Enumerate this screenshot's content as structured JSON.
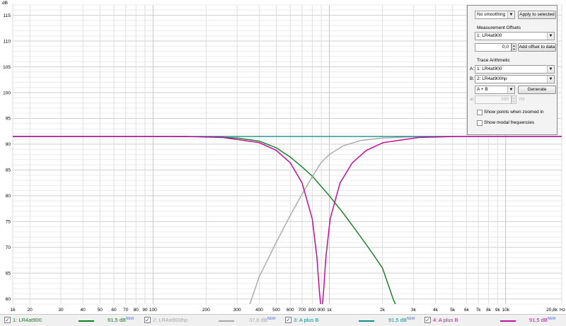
{
  "chart_data": {
    "type": "line",
    "xscale": "log",
    "xlim": [
      16,
      20800
    ],
    "ylim": [
      59,
      117
    ],
    "ylabel": "dB",
    "xunit": "Hz",
    "grid": true,
    "x_tick_labels": [
      {
        "v": 16,
        "t": "16"
      },
      {
        "v": 20,
        "t": "20"
      },
      {
        "v": 30,
        "t": "30"
      },
      {
        "v": 40,
        "t": "40"
      },
      {
        "v": 50,
        "t": "50"
      },
      {
        "v": 60,
        "t": "60"
      },
      {
        "v": 70,
        "t": "70"
      },
      {
        "v": 80,
        "t": "80"
      },
      {
        "v": 90,
        "t": "90"
      },
      {
        "v": 100,
        "t": "100"
      },
      {
        "v": 200,
        "t": "200"
      },
      {
        "v": 300,
        "t": "300"
      },
      {
        "v": 400,
        "t": "400"
      },
      {
        "v": 500,
        "t": "500"
      },
      {
        "v": 600,
        "t": "600"
      },
      {
        "v": 700,
        "t": "700"
      },
      {
        "v": 800,
        "t": "800"
      },
      {
        "v": 900,
        "t": "900"
      },
      {
        "v": 1000,
        "t": "1k"
      },
      {
        "v": 2000,
        "t": "2k"
      },
      {
        "v": 3000,
        "t": "3k"
      },
      {
        "v": 4000,
        "t": "4k"
      },
      {
        "v": 5000,
        "t": "5k"
      },
      {
        "v": 6000,
        "t": "6k"
      },
      {
        "v": 7000,
        "t": "7k"
      },
      {
        "v": 8000,
        "t": "8k"
      },
      {
        "v": 9000,
        "t": "9k"
      },
      {
        "v": 10000,
        "t": "10k"
      },
      {
        "v": 20800,
        "t": "20,8k"
      }
    ],
    "y_tick_labels": [
      {
        "v": 60,
        "t": "60"
      },
      {
        "v": 65,
        "t": "65"
      },
      {
        "v": 70,
        "t": "70"
      },
      {
        "v": 75,
        "t": "75"
      },
      {
        "v": 80,
        "t": "80"
      },
      {
        "v": 85,
        "t": "85"
      },
      {
        "v": 90,
        "t": "90"
      },
      {
        "v": 95,
        "t": "95"
      },
      {
        "v": 100,
        "t": "100"
      },
      {
        "v": 105,
        "t": "105"
      },
      {
        "v": 110,
        "t": "110"
      },
      {
        "v": 115,
        "t": "115"
      }
    ],
    "series": [
      {
        "name": "1: LR4at900",
        "color": "#0f7d1f",
        "points": [
          [
            16,
            91.5
          ],
          [
            100,
            91.5
          ],
          [
            200,
            91.45
          ],
          [
            300,
            91.2
          ],
          [
            400,
            90.6
          ],
          [
            500,
            89.3
          ],
          [
            600,
            87.5
          ],
          [
            700,
            85.6
          ],
          [
            800,
            83.8
          ],
          [
            900,
            81.8
          ],
          [
            1000,
            80.0
          ],
          [
            1200,
            76.6
          ],
          [
            1400,
            73.5
          ],
          [
            1600,
            70.8
          ],
          [
            1800,
            68.3
          ],
          [
            2000,
            66.0
          ],
          [
            2300,
            60.0
          ],
          [
            2400,
            58.5
          ]
        ]
      },
      {
        "name": "2: LR4at900hp",
        "color": "#a8a8a8",
        "points": [
          [
            350,
            58.5
          ],
          [
            400,
            64.3
          ],
          [
            500,
            71.0
          ],
          [
            600,
            76.2
          ],
          [
            700,
            80.3
          ],
          [
            800,
            83.7
          ],
          [
            900,
            86.5
          ],
          [
            1000,
            88.0
          ],
          [
            1200,
            89.7
          ],
          [
            1500,
            90.7
          ],
          [
            2000,
            91.2
          ],
          [
            3000,
            91.45
          ],
          [
            5000,
            91.5
          ],
          [
            20800,
            91.5
          ]
        ]
      },
      {
        "name": "3: A plus B",
        "color": "#188a8a",
        "points": [
          [
            16,
            91.5
          ],
          [
            20800,
            91.5
          ]
        ]
      },
      {
        "name": "4: A plus B",
        "color": "#c0109c",
        "points": [
          [
            16,
            91.5
          ],
          [
            150,
            91.5
          ],
          [
            250,
            91.3
          ],
          [
            400,
            90.3
          ],
          [
            500,
            88.8
          ],
          [
            600,
            86.4
          ],
          [
            700,
            82.5
          ],
          [
            800,
            75.5
          ],
          [
            850,
            68.0
          ],
          [
            880,
            61.0
          ],
          [
            895,
            58.5
          ],
          [
            910,
            58.5
          ],
          [
            925,
            61.0
          ],
          [
            955,
            68.0
          ],
          [
            1010,
            75.5
          ],
          [
            1150,
            82.5
          ],
          [
            1350,
            86.4
          ],
          [
            1620,
            88.8
          ],
          [
            2020,
            90.3
          ],
          [
            3200,
            91.3
          ],
          [
            5400,
            91.5
          ],
          [
            20800,
            91.5
          ]
        ]
      }
    ]
  },
  "panel": {
    "smoothing_value": "No smoothing",
    "apply_label": "Apply to selected",
    "offsets_heading": "Measurement Offsets",
    "offset_meas": "1: LR4at900",
    "offset_value": "0,0",
    "add_offset_label": "Add offset to data",
    "arith_heading": "Trace Arithmetic",
    "a_label": "A:",
    "a_value": "1: LR4at900",
    "b_label": "B:",
    "b_value": "2: LR4at900hp",
    "op_value": "A + B",
    "generate_label": "Generate",
    "freq_prefix": "at",
    "freq_value": "200",
    "freq_unit": "Hz",
    "show_points_label": "Show points when zoomed in",
    "show_modal_label": "Show modal frequencies"
  },
  "legend": [
    {
      "name": "1: LR4at900",
      "value": "91,5 dB",
      "badge": "NEW",
      "color": "#0f7d1f",
      "text_color": "#0f7d1f"
    },
    {
      "name": "2: LR4at900hp",
      "value": "37,6 dB",
      "badge": "NEW",
      "color": "#a8a8a8",
      "text_color": "#a8a8a8"
    },
    {
      "name": "3: A plus B",
      "value": "91,5 dB",
      "badge": "NEW",
      "color": "#188a8a",
      "text_color": "#188a8a"
    },
    {
      "name": "4: A plus B",
      "value": "91,5 dB",
      "badge": "NEW",
      "color": "#c0109c",
      "text_color": "#c0109c"
    }
  ]
}
